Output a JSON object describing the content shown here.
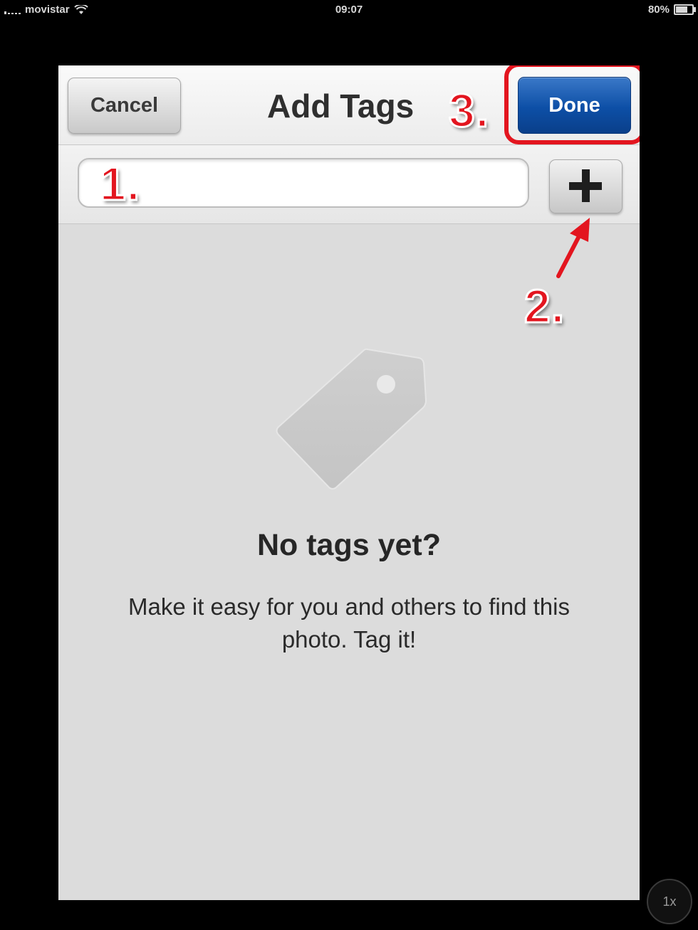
{
  "status_bar": {
    "carrier": "movistar",
    "time": "09:07",
    "battery": "80%",
    "battery_level": 0.8
  },
  "navbar": {
    "cancel_label": "Cancel",
    "title": "Add Tags",
    "done_label": "Done"
  },
  "input": {
    "placeholder": "",
    "value": ""
  },
  "empty_state": {
    "title": "No tags yet?",
    "description": "Make it easy for you and others to find this photo. Tag it!"
  },
  "annotations": {
    "step1": "1.",
    "step2": "2.",
    "step3": "3."
  },
  "zoom_badge": "1x",
  "colors": {
    "annotation_red": "#e3151f",
    "done_blue": "#0d4fa6"
  }
}
